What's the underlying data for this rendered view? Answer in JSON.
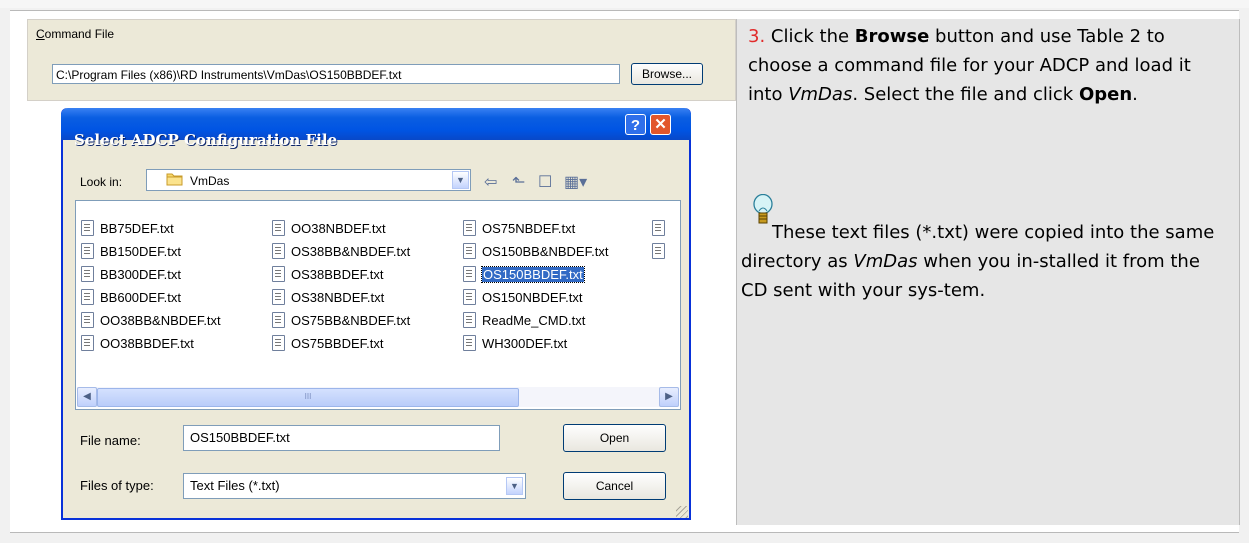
{
  "command_file": {
    "label_prefix": "C",
    "label_rest": "ommand File",
    "path": "C:\\Program Files (x86)\\RD Instruments\\VmDas\\OS150BBDEF.txt",
    "browse_label": "Browse..."
  },
  "dialog": {
    "title": "Select ADCP Configuration File",
    "help_glyph": "?",
    "close_glyph": "✕",
    "look_in_label": "Look in:",
    "look_in_value": "VmDas",
    "columns": [
      [
        "BB75DEF.txt",
        "BB150DEF.txt",
        "BB300DEF.txt",
        "BB600DEF.txt",
        "OO38BB&NBDEF.txt",
        "OO38BBDEF.txt"
      ],
      [
        "OO38NBDEF.txt",
        "OS38BB&NBDEF.txt",
        "OS38BBDEF.txt",
        "OS38NBDEF.txt",
        "OS75BB&NBDEF.txt",
        "OS75BBDEF.txt"
      ],
      [
        "OS75NBDEF.txt",
        "OS150BB&NBDEF.txt",
        "OS150BBDEF.txt",
        "OS150NBDEF.txt",
        "ReadMe_CMD.txt",
        "WH300DEF.txt"
      ]
    ],
    "selected_file": "OS150BBDEF.txt",
    "file_name_label": "File name:",
    "file_name_value": "OS150BBDEF.txt",
    "files_of_type_label": "Files of type:",
    "files_of_type_value": "Text Files (*.txt)",
    "open_label": "Open",
    "cancel_label": "Cancel",
    "scroll_thumb_glyph": "III"
  },
  "instructions": {
    "step_number": "3.",
    "t1": " Click the ",
    "browse_word": "Browse",
    "t2": " button and use Table 2 to choose a command file for your ADCP and load it into ",
    "vmdas1": "VmDas",
    "t3": ". Select the file and click ",
    "open_word": "Open",
    "t4": ".",
    "tip_t1": "These text files (*.txt) were copied into the same directory as ",
    "vmdas2": "VmDas",
    "tip_t2": " when you in-stalled it from the CD sent with your sys-tem."
  },
  "colors": {
    "titlebar": "#0054e3",
    "selection": "#316ac5",
    "step_number": "#e12b2b",
    "panel_bg": "#e6e6e6"
  }
}
